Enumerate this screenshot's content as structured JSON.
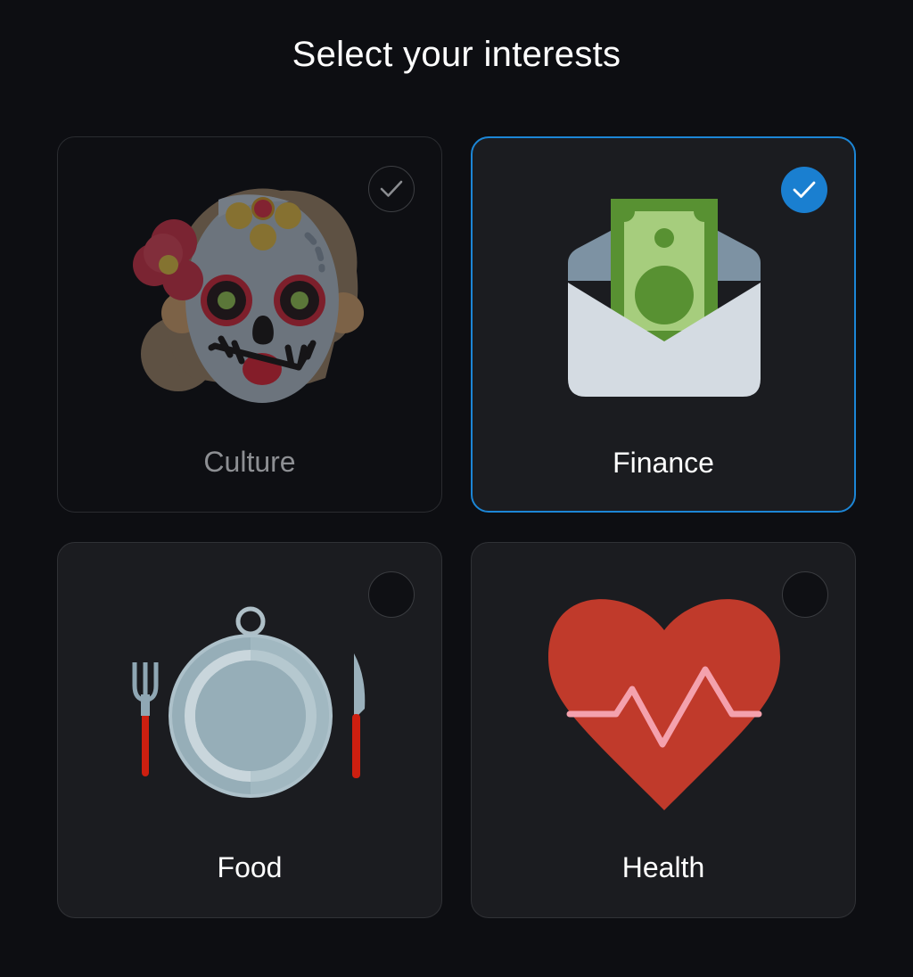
{
  "page": {
    "title": "Select your interests"
  },
  "cards": [
    {
      "label": "Culture",
      "state": "disabled",
      "icon": "sugar-skull-icon"
    },
    {
      "label": "Finance",
      "state": "selected",
      "icon": "money-envelope-icon"
    },
    {
      "label": "Food",
      "state": "unselected",
      "icon": "plate-cutlery-icon"
    },
    {
      "label": "Health",
      "state": "unselected",
      "icon": "heart-pulse-icon"
    }
  ],
  "colors": {
    "background": "#0d0e12",
    "card": "#1b1c20",
    "accent": "#1c86d6",
    "text": "#ffffff",
    "muted_text": "#8d8f93"
  }
}
